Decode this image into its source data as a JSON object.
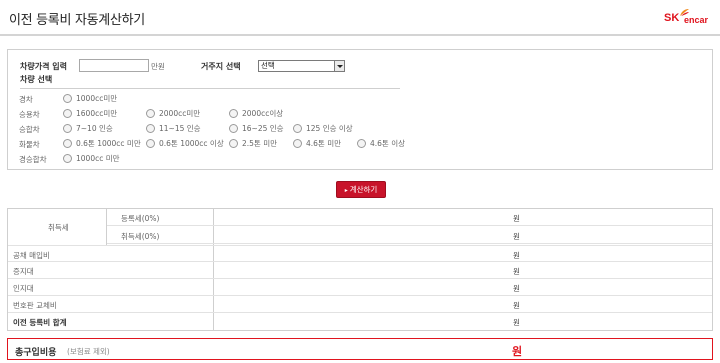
{
  "header": {
    "title": "이전 등록비 자동계산하기",
    "logo_sk": "SK",
    "logo_encar": "encar"
  },
  "form": {
    "price_label": "차량가격 입력",
    "price_value": "",
    "price_unit": "만원",
    "region_label": "거주지 선택",
    "region_selected": "선택",
    "vehicle_label": "차량 선택",
    "rows": [
      {
        "label": "경차",
        "options": [
          "1000cc미만"
        ]
      },
      {
        "label": "승용차",
        "options": [
          "1600cc미만",
          "2000cc미만",
          "2000cc이상"
        ]
      },
      {
        "label": "승합차",
        "options": [
          "7~10 인승",
          "11~15 인승",
          "16~25 인승",
          "125 인승 이상"
        ]
      },
      {
        "label": "화물차",
        "options": [
          "0.6톤 1000cc 미만",
          "0.6톤 1000cc 이상",
          "2.5톤 미만",
          "4.6톤 미만",
          "4.6톤 이상"
        ]
      },
      {
        "label": "경승합차",
        "options": [
          "1000cc 미만"
        ]
      }
    ],
    "calc_button": "계산하기"
  },
  "result": {
    "group_label": "취득세",
    "sub_rows": [
      "등록세(0%)",
      "취득세(0%)"
    ],
    "rows": [
      "공채 매입비",
      "증지대",
      "인지대",
      "번호판 교체비",
      "이전 등록비 합계"
    ],
    "won": "원"
  },
  "total": {
    "label": "총구입비용",
    "note": "(보험료 제외)",
    "won": "원"
  },
  "colors": {
    "accent": "#e0141e",
    "button": "#c8132a"
  }
}
